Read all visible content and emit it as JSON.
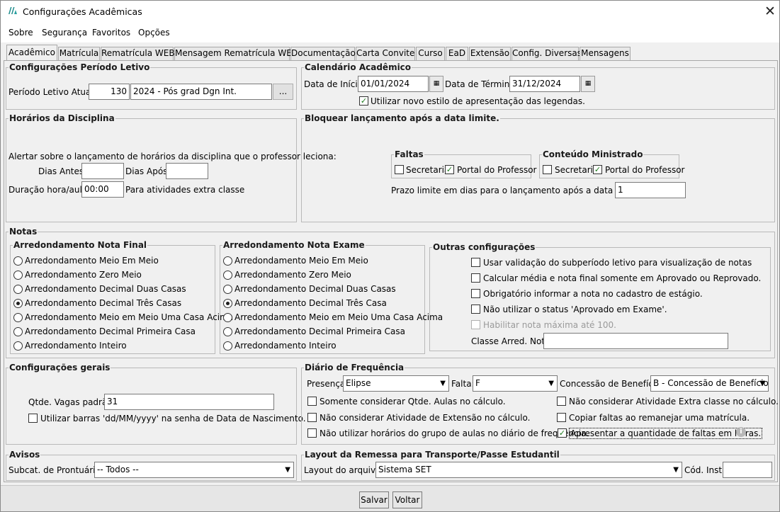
{
  "window": {
    "title": "Configurações Acadêmicas"
  },
  "menu": [
    "Sobre",
    "Segurança",
    "Favoritos",
    "Opções"
  ],
  "tabs": [
    "Acadêmico",
    "Matrícula",
    "Rematrícula WEB",
    "Mensagem Rematrícula WEB",
    "Documentação",
    "Carta Convite",
    "Curso",
    "EaD",
    "Extensão",
    "Config. Diversas",
    "Mensagens"
  ],
  "periodo": {
    "legend": "Configurações Período Letivo",
    "label": "Período Letivo Atual:",
    "code": "130",
    "name": "2024 - Pós grad Dgn Int.",
    "browse": "..."
  },
  "calendario": {
    "legend": "Calendário Acadêmico",
    "inicio_label": "Data de Início:",
    "inicio": "01/01/2024",
    "termino_label": "Data de Término:",
    "termino": "31/12/2024",
    "legendas_label": "Utilizar novo estilo de apresentação das legendas.",
    "legendas_checked": true
  },
  "horarios": {
    "legend": "Horários da Disciplina",
    "alert": "Alertar sobre o lançamento de horários da disciplina que o professor leciona:",
    "antes_label": "Dias Antes:",
    "antes": "",
    "apos_label": "Dias Após:",
    "apos": "",
    "duracao_label": "Duração hora/aula:",
    "duracao": "00:00",
    "extra": "Para atividades extra classe"
  },
  "bloquear": {
    "legend": "Bloquear lançamento após a data limite.",
    "faltas": {
      "legend": "Faltas",
      "secretaria": "Secretaria",
      "secretaria_checked": false,
      "portal": "Portal do Professor",
      "portal_checked": true
    },
    "conteudo": {
      "legend": "Conteúdo Ministrado",
      "secretaria": "Secretaria",
      "secretaria_checked": false,
      "portal": "Portal do Professor",
      "portal_checked": true
    },
    "prazo_label": "Prazo limite em dias para o lançamento após a data da aula:",
    "prazo": "1"
  },
  "notas": {
    "legend": "Notas",
    "final": {
      "legend": "Arredondamento Nota Final",
      "options": [
        "Arredondamento Meio Em Meio",
        "Arredondamento Zero Meio",
        "Arredondamento Decimal Duas Casas",
        "Arredondamento Decimal Três Casas",
        "Arredondamento Meio em Meio Uma Casa Acima",
        "Arredondamento Decimal Primeira Casa",
        "Arredondamento Inteiro"
      ],
      "selected": 3
    },
    "exame": {
      "legend": "Arredondamento Nota Exame",
      "options": [
        "Arredondamento Meio Em Meio",
        "Arredondamento Zero Meio",
        "Arredondamento Decimal Duas Casas",
        "Arredondamento Decimal Três Casa",
        "Arredondamento Meio em Meio Uma Casa Acima",
        "Arredondamento Decimal Primeira Casa",
        "Arredondamento Inteiro"
      ],
      "selected": 3
    },
    "outras": {
      "legend": "Outras configurações",
      "items": [
        {
          "label": "Usar validação do subperíodo letivo para visualização de notas",
          "checked": false,
          "disabled": false
        },
        {
          "label": "Calcular média e nota final somente em Aprovado ou Reprovado.",
          "checked": false,
          "disabled": false
        },
        {
          "label": "Obrigatório informar a nota no cadastro de estágio.",
          "checked": false,
          "disabled": false
        },
        {
          "label": "Não utilizar o status 'Aprovado em Exame'.",
          "checked": false,
          "disabled": false
        },
        {
          "label": "Habilitar nota máxima até 100.",
          "checked": false,
          "disabled": true
        }
      ],
      "classe_label": "Classe Arred. Nota:",
      "classe": ""
    }
  },
  "gerais": {
    "legend": "Configurações gerais",
    "vagas_label": "Qtde. Vagas padrão:",
    "vagas": "31",
    "barras_label": "Utilizar barras 'dd/MM/yyyy' na senha de Data de Nascimento.",
    "barras_checked": false
  },
  "diario": {
    "legend": "Diário de Frequência",
    "presenca_label": "Presença:",
    "presenca": "Elipse",
    "falta_label": "Falta:",
    "falta": "F",
    "beneficio_label": "Concessão de Benefício:",
    "beneficio": "B - Concessão de Benefício",
    "options": [
      {
        "label": "Somente considerar Qtde. Aulas no cálculo.",
        "checked": false
      },
      {
        "label": "Não considerar Atividade Extra classe no cálculo.",
        "checked": false
      },
      {
        "label": "Não considerar Atividade de Extensão no cálculo.",
        "checked": false
      },
      {
        "label": "Copiar faltas ao remanejar uma matrícula.",
        "checked": false
      },
      {
        "label": "Não utilizar horários do grupo de aulas no diário de frequência.",
        "checked": false
      },
      {
        "label": "Apresentar a quantidade de faltas em horas.",
        "checked": true
      }
    ],
    "info": "i"
  },
  "avisos": {
    "legend": "Avisos",
    "subcat_label": "Subcat. de Prontuário:",
    "subcat": "-- Todos --"
  },
  "layout": {
    "legend": "Layout da Remessa para Transporte/Passe Estudantil",
    "arquivo_label": "Layout do arquivo:",
    "arquivo": "Sistema SET",
    "cod_label": "Cód. Inst.:",
    "cod": ""
  },
  "buttons": {
    "salvar": "Salvar",
    "voltar": "Voltar"
  },
  "colors": {
    "check": "#1a7a1a",
    "logo": "#1a8a8a"
  }
}
